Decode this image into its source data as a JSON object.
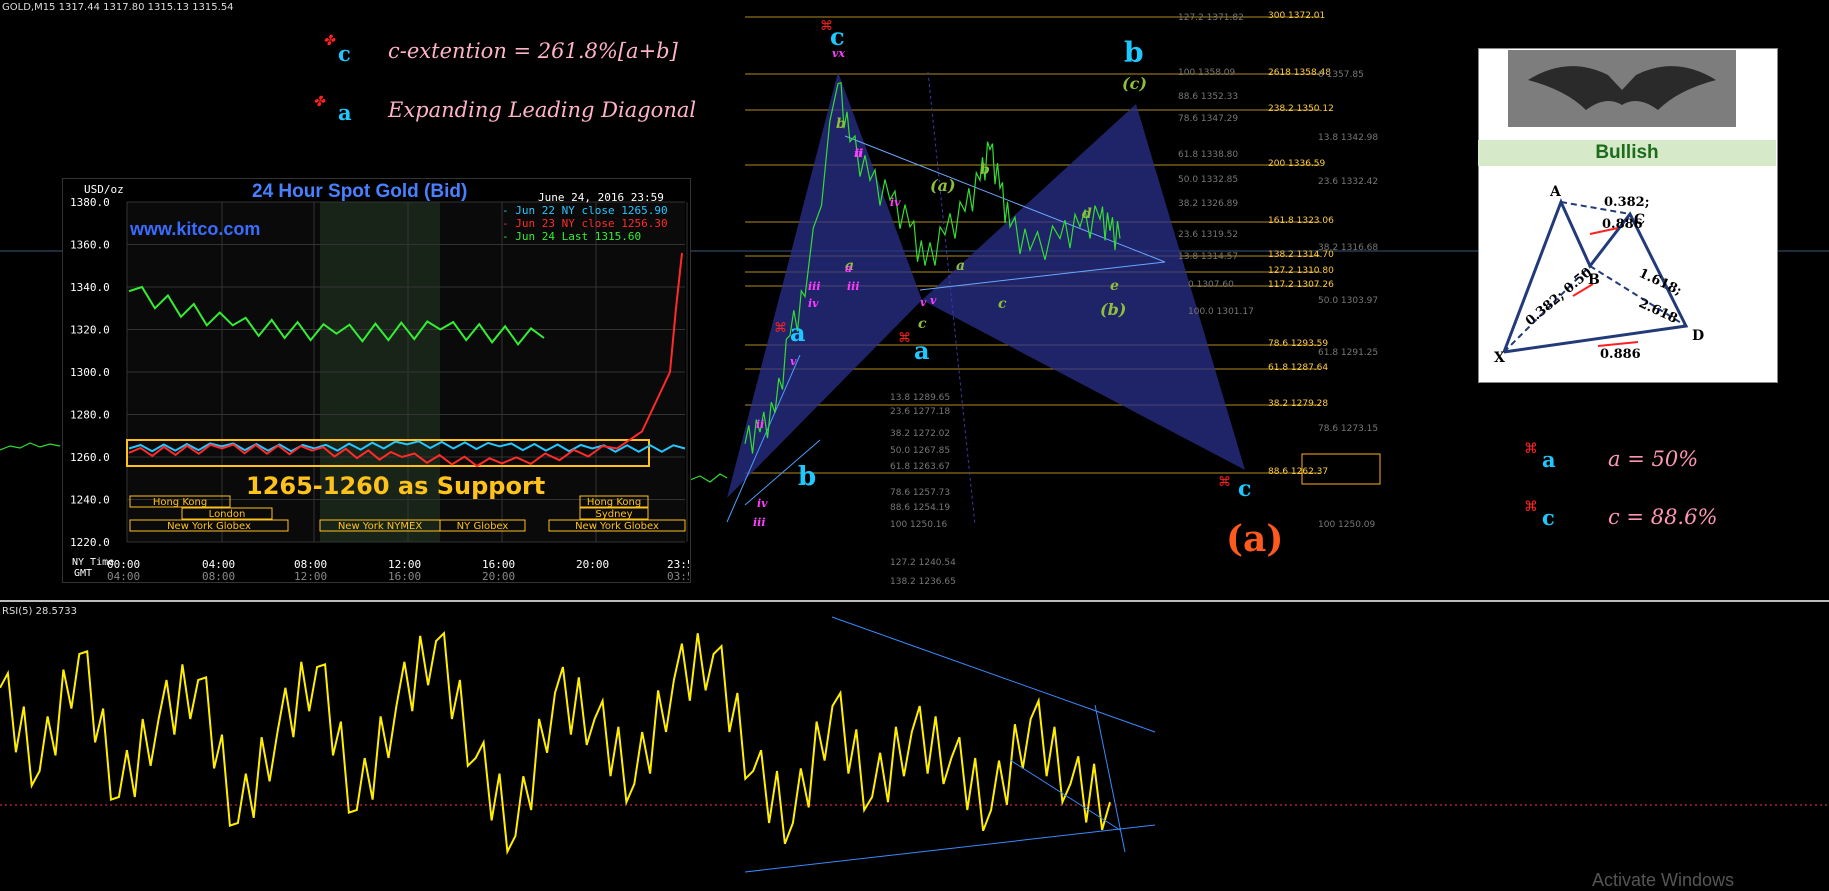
{
  "header": {
    "symbol_text": "GOLD,M15  1317.44 1317.80 1315.13 1315.54"
  },
  "rsi": {
    "label": "RSI(5) 28.5733"
  },
  "notes": {
    "c_ext_mark": "c",
    "c_ext_text": "c-extention = 261.8%[a+b]",
    "diag_mark": "a",
    "diag_text": "Expanding Leading Diagonal",
    "ratio_a_mark": "a",
    "ratio_a_text": "a = 50%",
    "ratio_c_mark": "c",
    "ratio_c_text": "c = 88.6%"
  },
  "kitco": {
    "title": "24 Hour Spot Gold (Bid)",
    "date": "June 24, 2016 23:59",
    "site": "www.kitco.com",
    "unit": "USD/oz",
    "support_text": "1265-1260 as Support",
    "legend": [
      {
        "text": "Jun 22 NY close 1265.90",
        "color": "#26c6ff"
      },
      {
        "text": "Jun 23 NY close 1256.30",
        "color": "#ff2a2a"
      },
      {
        "text": "Jun 24 Last 1315.60",
        "color": "#33ee33"
      }
    ],
    "y_ticks": [
      "1380.0",
      "1360.0",
      "1340.0",
      "1320.0",
      "1300.0",
      "1280.0",
      "1260.0",
      "1240.0",
      "1220.0"
    ],
    "ny_label": "NY Time",
    "gmt_label": "GMT",
    "ny_times": [
      "00:00",
      "04:00",
      "08:00",
      "12:00",
      "16:00",
      "20:00",
      "23:59"
    ],
    "gmt_times": [
      "04:00",
      "08:00",
      "12:00",
      "16:00",
      "20:00",
      "03:59"
    ],
    "sessions": [
      "Hong Kong",
      "London",
      "New York Globex",
      "New York NYMEX",
      "NY Globex",
      "Hong Kong",
      "Sydney",
      "New York Globex"
    ]
  },
  "wave_labels": [
    {
      "text": "c",
      "color": "#1ec8ff",
      "size": 24
    },
    {
      "text": "b",
      "color": "#1ec8ff",
      "size": 28
    },
    {
      "text": "(c)",
      "color": "#8fbf3a",
      "size": 16
    },
    {
      "text": "a",
      "color": "#1ec8ff",
      "size": 24
    },
    {
      "text": "a",
      "color": "#1ec8ff",
      "size": 24
    },
    {
      "text": "b",
      "color": "#1ec8ff",
      "size": 26
    },
    {
      "text": "c",
      "color": "#1ec8ff",
      "size": 22
    },
    {
      "text": "(a)",
      "color": "#ff5a1e",
      "size": 36
    },
    {
      "text": "(a)",
      "color": "#8fbf3a",
      "size": 16
    },
    {
      "text": "b",
      "color": "#8fbf3a",
      "size": 14
    },
    {
      "text": "a",
      "color": "#8fbf3a",
      "size": 14
    },
    {
      "text": "c",
      "color": "#8fbf3a",
      "size": 14
    },
    {
      "text": "d",
      "color": "#8fbf3a",
      "size": 14
    },
    {
      "text": "e",
      "color": "#8fbf3a",
      "size": 14
    },
    {
      "text": "c",
      "color": "#8fbf3a",
      "size": 14
    },
    {
      "text": "(b)",
      "color": "#8fbf3a",
      "size": 16
    },
    {
      "text": "b",
      "color": "#8fbf3a",
      "size": 14
    },
    {
      "text": "a",
      "color": "#8fbf3a",
      "size": 14
    },
    {
      "text": "ii",
      "color": "#ff3cff",
      "size": 11
    },
    {
      "text": "iii",
      "color": "#ff3cff",
      "size": 11
    },
    {
      "text": "iv",
      "color": "#ff3cff",
      "size": 11
    },
    {
      "text": "v",
      "color": "#ff3cff",
      "size": 11
    },
    {
      "text": "ii",
      "color": "#ff3cff",
      "size": 11
    },
    {
      "text": "iii",
      "color": "#ff3cff",
      "size": 11
    },
    {
      "text": "iv",
      "color": "#ff3cff",
      "size": 11
    },
    {
      "text": "v",
      "color": "#ff3cff",
      "size": 11
    },
    {
      "text": "iii",
      "color": "#ff3cff",
      "size": 11
    },
    {
      "text": "iv",
      "color": "#ff3cff",
      "size": 11
    },
    {
      "text": "ii",
      "color": "#ff3cff",
      "size": 11
    },
    {
      "text": "v",
      "color": "#ff3cff",
      "size": 11
    },
    {
      "text": "vx",
      "color": "#ff3cff",
      "size": 11
    },
    {
      "text": "a",
      "color": "#ff3cff",
      "size": 11
    }
  ],
  "fib_left": [
    "127.2 1371.82",
    "100 1358.09",
    "88.6 1352.33",
    "78.6 1347.29",
    "61.8 1338.80",
    "50.0 1332.85",
    "38.2 1326.89",
    "23.6 1319.52",
    "13.8 1314.57",
    "0 1307.60",
    "100.0  1301.17",
    "13.8 1289.65",
    "23.6 1277.18",
    "38.2 1272.02",
    "50.0 1267.85",
    "61.8 1263.67",
    "78.6 1257.73",
    "88.6 1254.19",
    "100 1250.16",
    "127.2 1240.54",
    "138.2 1236.65"
  ],
  "fib_right": [
    "300 1372.01",
    "2618 1358.48",
    "238.2 1350.12",
    "200 1336.59",
    "161.8 1323.06",
    "138.2 1314.70",
    "127.2 1310.80",
    "117.2 1307.26",
    "78.6 1293.59",
    "61.8 1287.64",
    "38.2 1279.28",
    "88.6 1262.37"
  ],
  "fib_far": [
    "0 1357.85",
    "13.8 1342.98",
    "23.6 1332.42",
    "38.2 1316.68",
    "50.0 1303.97",
    "61.8 1291.25",
    "78.6 1273.15",
    "100 1250.09"
  ],
  "gartley": {
    "title": "Bullish",
    "points": [
      "A",
      "B",
      "C",
      "D",
      "X"
    ],
    "ratios": [
      "0.382;",
      "0.886",
      "0.382; 0.50",
      "1.618;",
      "2.618",
      "0.886"
    ]
  },
  "watermark": "Activate Windows",
  "chart_data": [
    {
      "type": "line",
      "title": "GOLD,M15",
      "series": [
        {
          "name": "GOLD,M15",
          "values": [
            1262,
            1265,
            1270,
            1290,
            1300,
            1355,
            1340,
            1330,
            1325,
            1318,
            1308,
            1316,
            1322,
            1330,
            1338,
            1328,
            1318,
            1312,
            1315,
            1318,
            1320,
            1317,
            1315
          ]
        }
      ]
    },
    {
      "type": "line",
      "title": "24 Hour Spot Gold (Bid)",
      "ylabel": "USD/oz",
      "ylim": [
        1220,
        1380
      ],
      "x": [
        "00:00",
        "04:00",
        "08:00",
        "12:00",
        "16:00",
        "20:00",
        "23:59"
      ],
      "series": [
        {
          "name": "Jun 22 NY close 1265.90",
          "values": [
            1264,
            1265,
            1264,
            1266,
            1265,
            1264,
            1264
          ]
        },
        {
          "name": "Jun 23 NY close 1256.30",
          "values": [
            1262,
            1264,
            1263,
            1260,
            1257,
            1264,
            1356
          ]
        },
        {
          "name": "Jun 24 Last 1315.60",
          "values": [
            1338,
            1322,
            1318,
            1320,
            1316
          ]
        }
      ]
    },
    {
      "type": "line",
      "title": "RSI(5) 28.5733",
      "series": [
        {
          "name": "RSI(5)",
          "values": [
            72,
            40,
            85,
            30,
            60,
            75,
            20,
            55,
            80,
            25,
            65,
            90,
            45,
            15,
            70,
            60,
            35,
            75,
            85,
            40,
            20,
            65,
            30,
            55,
            45,
            25,
            60,
            35,
            28
          ]
        }
      ]
    }
  ]
}
